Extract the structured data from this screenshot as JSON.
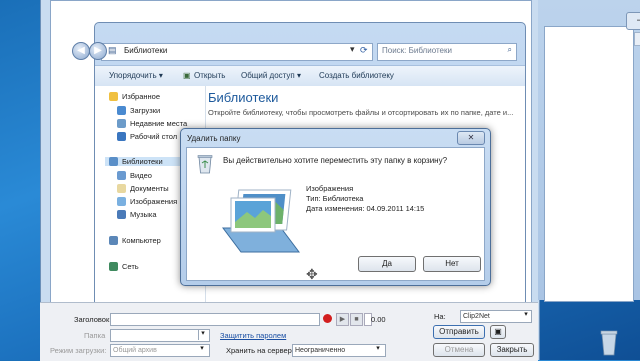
{
  "explorer": {
    "address": "Библиотеки",
    "search_placeholder": "Поиск: Библиотеки",
    "toolbar": {
      "organize": "Упорядочить ▾",
      "open": "Открыть",
      "share": "Общий доступ ▾",
      "create_library": "Создать библиотеку"
    },
    "nav": {
      "favorites": "Избранное",
      "downloads": "Загрузки",
      "recent": "Недавние места",
      "desktop": "Рабочий стол",
      "libraries": "Библиотеки",
      "video": "Видео",
      "documents": "Документы",
      "images": "Изображения",
      "music": "Музыка",
      "computer": "Компьютер",
      "network": "Сеть"
    },
    "content": {
      "heading": "Библиотеки",
      "description": "Откройте библиотеку, чтобы просмотреть файлы и отсортировать их по папке, дате и..."
    }
  },
  "dialog": {
    "title": "Удалить папку",
    "close": "✕",
    "question": "Вы действительно хотите переместить эту папку в корзину?",
    "name": "Изображения",
    "type": "Тип: Библиотека",
    "modified": "Дата изменения: 04.09.2011 14:15",
    "yes": "Да",
    "no": "Нет"
  },
  "clip2net": {
    "title_label": "Заголовок:",
    "folder_label": "Папка",
    "mode_label": "Режим загрузки:",
    "mode_value": "Общий архив",
    "password_link": "Защитить паролем",
    "keep_label": "Хранить на сервере:",
    "keep_value": "Неограниченно",
    "timer": "0.00",
    "to_label": "На:",
    "to_value": "Clip2Net",
    "send": "Отправить",
    "cancel": "Отмена",
    "close": "Закрыть"
  },
  "right_window": {
    "button": "–"
  },
  "colors": {
    "accent": "#1e5a9c",
    "link": "#1a4fa3",
    "record": "#d21e1e"
  }
}
